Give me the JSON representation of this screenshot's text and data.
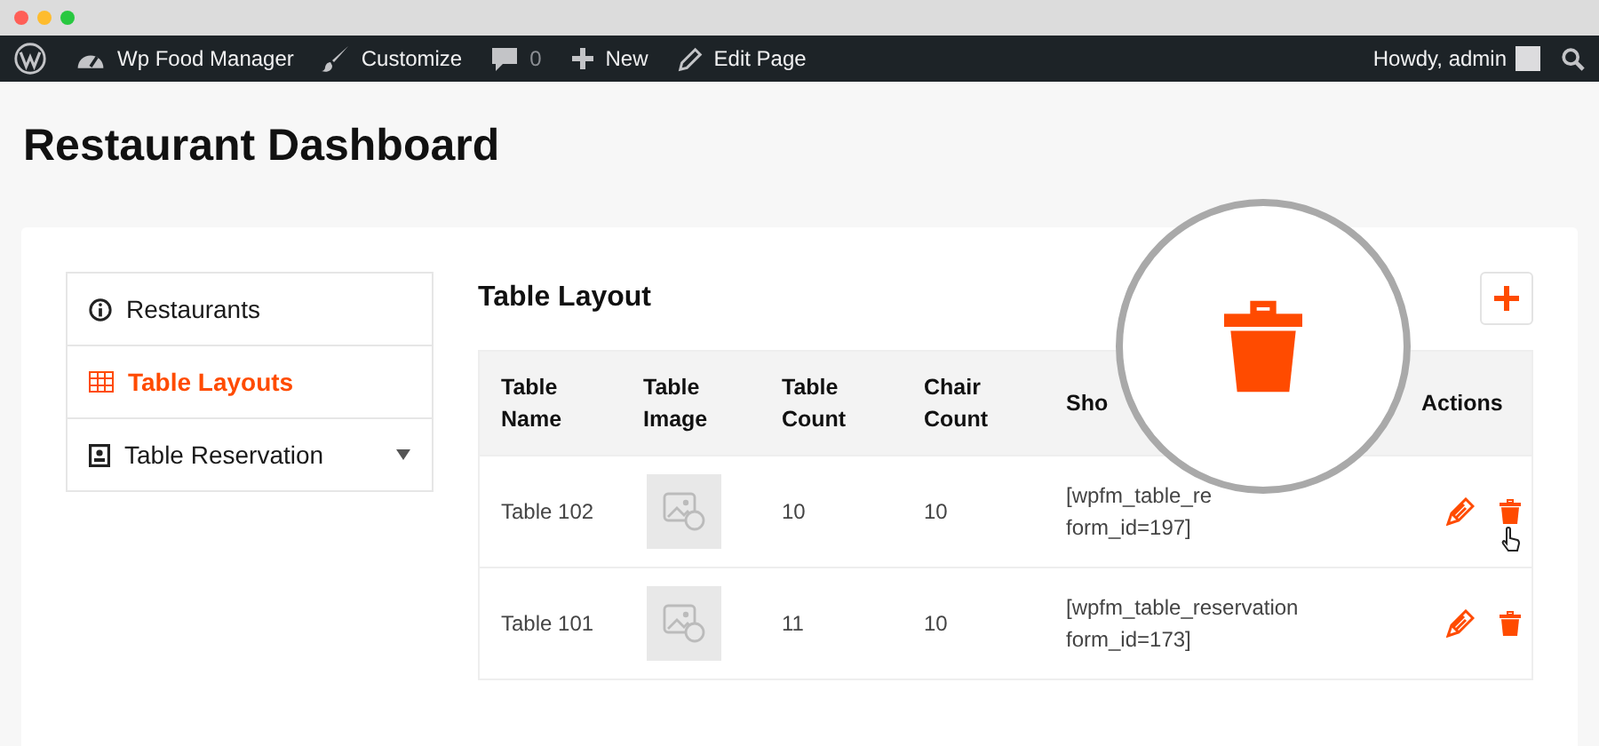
{
  "admin_bar": {
    "items": [
      {
        "kind": "wordpress"
      },
      {
        "kind": "dashboard",
        "label": "Wp Food Manager"
      },
      {
        "kind": "customize",
        "label": "Customize"
      },
      {
        "kind": "comments",
        "label": "0"
      },
      {
        "kind": "new",
        "label": "New"
      },
      {
        "kind": "edit",
        "label": "Edit Page"
      }
    ],
    "greeting": "Howdy, admin"
  },
  "page_title": "Restaurant Dashboard",
  "sidebar": {
    "items": [
      {
        "kind": "info",
        "label": "Restaurants",
        "selected": false,
        "has_submenu": false
      },
      {
        "kind": "grid",
        "label": "Table Layouts",
        "selected": true,
        "has_submenu": false
      },
      {
        "kind": "book",
        "label": "Table Reservation",
        "selected": false,
        "has_submenu": true
      }
    ]
  },
  "section_title": "Table Layout",
  "table": {
    "columns": [
      "Table Name",
      "Table Image",
      "Table Count",
      "Chair Count",
      "Sho",
      "Actions"
    ],
    "rows": [
      {
        "name": "Table 102",
        "table_count": "10",
        "chair_count": "10",
        "shortcode": [
          "[wpfm_table_re",
          "form_id=197]"
        ],
        "cursor_on_delete": true
      },
      {
        "name": "Table 101",
        "table_count": "11",
        "chair_count": "10",
        "shortcode": [
          "[wpfm_table_reservation",
          "form_id=173]"
        ],
        "cursor_on_delete": false
      }
    ]
  }
}
